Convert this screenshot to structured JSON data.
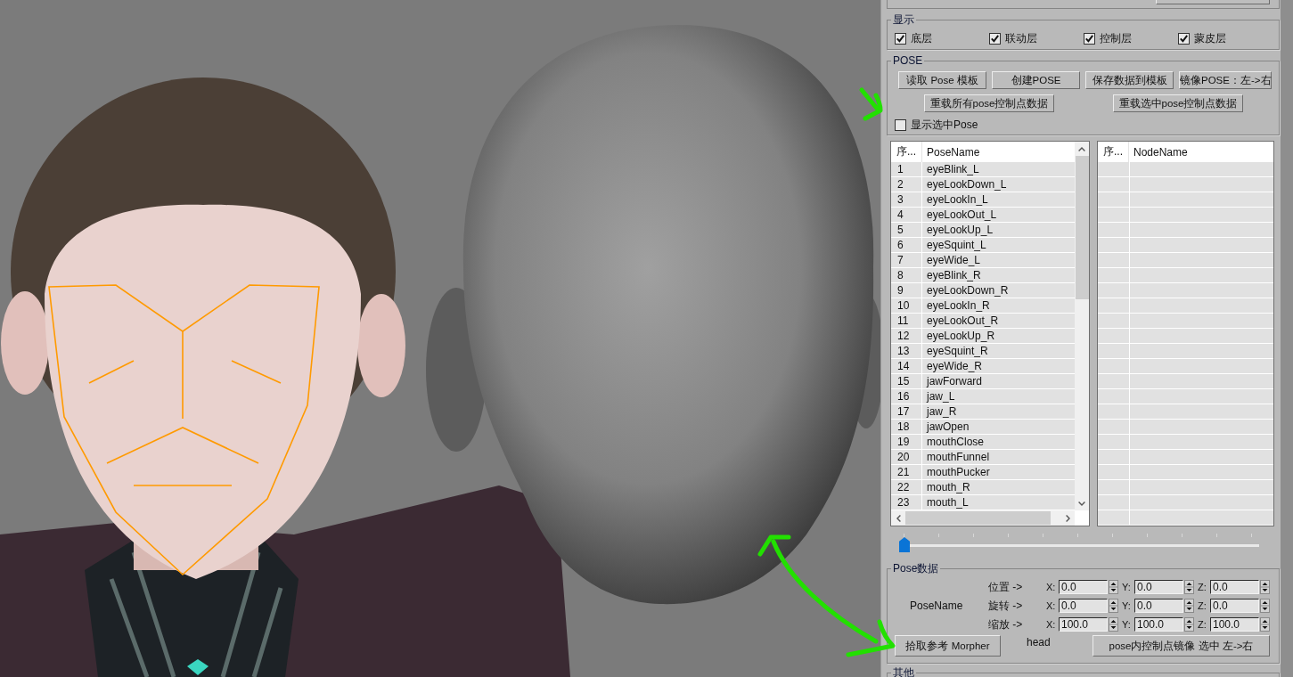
{
  "panel": {
    "display": {
      "title": "显示",
      "layers": [
        {
          "label": "底层",
          "checked": true
        },
        {
          "label": "联动层",
          "checked": true
        },
        {
          "label": "控制层",
          "checked": true
        },
        {
          "label": "蒙皮层",
          "checked": true
        }
      ]
    },
    "pose": {
      "title": "POSE",
      "buttons": [
        "读取 Pose 模板",
        "创建POSE",
        "保存数据到模板",
        "镜像POSE：左->右"
      ],
      "reload_buttons": [
        "重载所有pose控制点数据",
        "重载选中pose控制点数据"
      ],
      "show_selected": {
        "label": "显示选中Pose",
        "checked": false
      }
    },
    "pose_list": {
      "columns": [
        "序...",
        "PoseName"
      ],
      "rows": [
        {
          "index": "1",
          "name": "eyeBlink_L",
          "selected": false
        },
        {
          "index": "2",
          "name": "eyeLookDown_L",
          "selected": false
        },
        {
          "index": "3",
          "name": "eyeLookIn_L",
          "selected": false
        },
        {
          "index": "4",
          "name": "eyeLookOut_L",
          "selected": false
        },
        {
          "index": "5",
          "name": "eyeLookUp_L",
          "selected": false
        },
        {
          "index": "6",
          "name": "eyeSquint_L",
          "selected": false
        },
        {
          "index": "7",
          "name": "eyeWide_L",
          "selected": false
        },
        {
          "index": "8",
          "name": "eyeBlink_R",
          "selected": false
        },
        {
          "index": "9",
          "name": "eyeLookDown_R",
          "selected": false
        },
        {
          "index": "10",
          "name": "eyeLookIn_R",
          "selected": false
        },
        {
          "index": "11",
          "name": "eyeLookOut_R",
          "selected": false
        },
        {
          "index": "12",
          "name": "eyeLookUp_R",
          "selected": false
        },
        {
          "index": "13",
          "name": "eyeSquint_R",
          "selected": false
        },
        {
          "index": "14",
          "name": "eyeWide_R",
          "selected": false
        },
        {
          "index": "15",
          "name": "jawForward",
          "selected": false
        },
        {
          "index": "16",
          "name": "jaw_L",
          "selected": false
        },
        {
          "index": "17",
          "name": "jaw_R",
          "selected": false
        },
        {
          "index": "18",
          "name": "jawOpen",
          "selected": false
        },
        {
          "index": "19",
          "name": "mouthClose",
          "selected": false
        },
        {
          "index": "20",
          "name": "mouthFunnel",
          "selected": false
        },
        {
          "index": "21",
          "name": "mouthPucker",
          "selected": false
        },
        {
          "index": "22",
          "name": "mouth_R",
          "selected": false
        },
        {
          "index": "23",
          "name": "mouth_L",
          "selected": false
        }
      ]
    },
    "node_list": {
      "columns": [
        "序...",
        "NodeName"
      ]
    },
    "slider": {
      "level": 0
    },
    "pose_data": {
      "title": "Pose数据",
      "name_label": "PoseName",
      "transforms": [
        {
          "label": "位置 ->",
          "fields": [
            {
              "axis": "X:",
              "value": "0.0"
            },
            {
              "axis": "Y:",
              "value": "0.0"
            },
            {
              "axis": "Z:",
              "value": "0.0"
            }
          ]
        },
        {
          "label": "旋转 ->",
          "fields": [
            {
              "axis": "X:",
              "value": "0.0"
            },
            {
              "axis": "Y:",
              "value": "0.0"
            },
            {
              "axis": "Z:",
              "value": "0.0"
            }
          ]
        },
        {
          "label": "缩放 ->",
          "fields": [
            {
              "axis": "X:",
              "value": "100.0"
            },
            {
              "axis": "Y:",
              "value": "100.0"
            },
            {
              "axis": "Z:",
              "value": "100.0"
            }
          ]
        }
      ],
      "pick_button": "拾取参考 Morpher",
      "reference": "head",
      "mirror_button": "pose内控制点镜像 选中 左->右"
    },
    "other": {
      "title": "其他"
    }
  }
}
